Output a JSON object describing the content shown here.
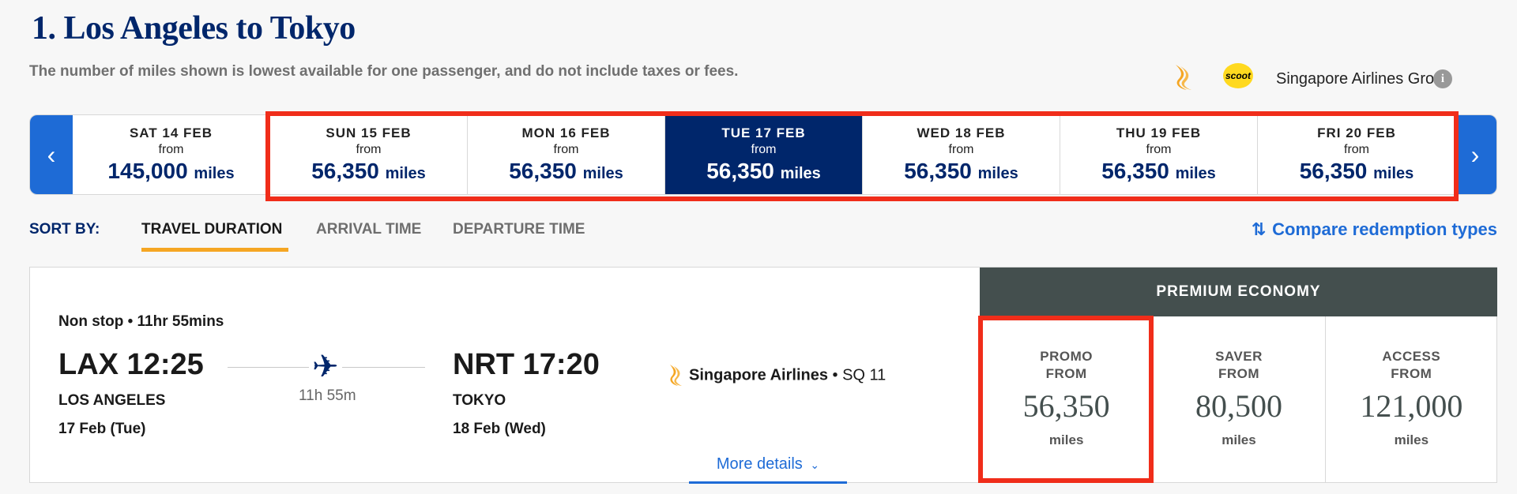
{
  "page_title": "1. Los Angeles to Tokyo",
  "disclaimer": "The number of miles shown is lowest available for one passenger, and do not include taxes or fees.",
  "airline_group": {
    "scoot_logo_text": "scoot",
    "label": "Singapore Airlines Group",
    "info_symbol": "i"
  },
  "date_strip": {
    "prev_arrow": "‹",
    "next_arrow": "›",
    "from_label": "from",
    "unit": "miles",
    "dates": [
      {
        "date": "SAT 14 FEB",
        "miles": "145,000"
      },
      {
        "date": "SUN 15 FEB",
        "miles": "56,350"
      },
      {
        "date": "MON 16 FEB",
        "miles": "56,350"
      },
      {
        "date": "TUE 17 FEB",
        "miles": "56,350",
        "selected": true
      },
      {
        "date": "WED 18 FEB",
        "miles": "56,350"
      },
      {
        "date": "THU 19 FEB",
        "miles": "56,350"
      },
      {
        "date": "FRI 20 FEB",
        "miles": "56,350"
      }
    ]
  },
  "sort": {
    "label": "SORT BY:",
    "options": [
      "TRAVEL DURATION",
      "ARRIVAL TIME",
      "DEPARTURE TIME"
    ],
    "active": "TRAVEL DURATION"
  },
  "compare": {
    "icon": "⇅",
    "label": "Compare redemption types"
  },
  "flight": {
    "stops": "Non stop • 11hr 55mins",
    "departure": {
      "code_time": "LAX 12:25",
      "city": "LOS ANGELES",
      "date": "17 Feb (Tue)"
    },
    "duration": "11h 55m",
    "arrival": {
      "code_time": "NRT 17:20",
      "city": "TOKYO",
      "date": "18 Feb (Wed)"
    },
    "carrier": "Singapore Airlines",
    "flight_no": " • SQ 11",
    "more_details": "More details"
  },
  "cabin": {
    "name": "PREMIUM ECONOMY",
    "fares": [
      {
        "type": "PROMO",
        "from": "FROM",
        "value": "56,350",
        "unit": "miles"
      },
      {
        "type": "SAVER",
        "from": "FROM",
        "value": "80,500",
        "unit": "miles"
      },
      {
        "type": "ACCESS",
        "from": "FROM",
        "value": "121,000",
        "unit": "miles"
      }
    ]
  },
  "colors": {
    "brand_navy": "#00266b",
    "link_blue": "#1e6bd6",
    "highlight_red": "#f02d1a",
    "sort_accent": "#f5a623",
    "cabin_header": "#444f4e"
  }
}
